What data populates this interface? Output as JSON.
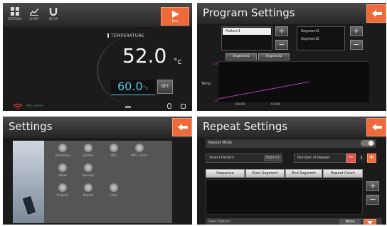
{
  "panel1": {
    "toolbar": [
      {
        "label": "SETTINGS",
        "icon": "grid-icon"
      },
      {
        "label": "CHART",
        "icon": "chart-icon"
      },
      {
        "label": "SETUP",
        "icon": "magnet-icon"
      }
    ],
    "run_label": "Run",
    "temperature_label": "TEMPERATURE",
    "current_temp": "52.0",
    "current_unit": "°c",
    "setpoint": "60.0",
    "setpoint_unit": "°c",
    "set_label": "SET",
    "status_text": "Not paired",
    "colors": {
      "accent": "#ee6a3a",
      "setpoint": "#59c7e0",
      "wifi": "#e0352b"
    }
  },
  "panel2": {
    "title": "Program Settings",
    "patterns": [
      "Pattern1"
    ],
    "segments": [
      "Segment1",
      "Segment2"
    ],
    "plot_tabs": [
      "Segment1",
      "Segment2"
    ],
    "y_label": "Temp",
    "y_ticks": [
      "100",
      "25"
    ],
    "x_ticks": [
      "00:00",
      "01:00"
    ],
    "line_color": "#b43fb4"
  },
  "panel3": {
    "title": "Settings",
    "items": [
      {
        "label": "Operations",
        "icon": "operations-icon"
      },
      {
        "label": "System",
        "icon": "system-icon"
      },
      {
        "label": "WiFi",
        "icon": "wifi-icon"
      },
      {
        "label": "WiFi - Users",
        "icon": "users-icon"
      },
      {
        "label": "About",
        "icon": "info-icon"
      },
      {
        "label": "Security",
        "icon": "lock-icon"
      },
      {
        "label": "Program",
        "icon": "program-icon"
      },
      {
        "label": "Repeat",
        "icon": "repeat-icon"
      },
      {
        "label": "Units",
        "icon": "clock-icon"
      }
    ]
  },
  "panel4": {
    "title": "Repeat Settings",
    "repeat_mode_label": "Repeat Mode",
    "select_pattern_label": "Select Pattern",
    "select_pattern_value": "Pattern1",
    "number_of_repeat_label": "Number of Repeat",
    "number_of_repeat_value": "1",
    "headers": [
      "Sequence",
      "Start Segment",
      "End Segment",
      "Repeat Count"
    ],
    "next_pattern_label": "Next Pattern",
    "next_pattern_value": "None"
  }
}
